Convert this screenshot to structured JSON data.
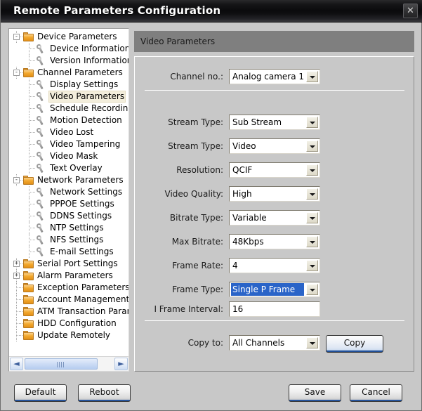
{
  "window": {
    "title": "Remote Parameters Configuration",
    "close_icon": "close-icon",
    "close_glyph": "✕"
  },
  "tree": {
    "nodes": [
      {
        "label": "Device Parameters",
        "depth": 0,
        "icon": "folder-icon",
        "expander": "-",
        "selected": false
      },
      {
        "label": "Device Information",
        "depth": 1,
        "icon": "wrench-icon",
        "expander": "",
        "selected": false
      },
      {
        "label": "Version Information",
        "depth": 1,
        "icon": "wrench-icon",
        "expander": "",
        "selected": false
      },
      {
        "label": "Channel Parameters",
        "depth": 0,
        "icon": "folder-icon",
        "expander": "-",
        "selected": false
      },
      {
        "label": "Display Settings",
        "depth": 1,
        "icon": "wrench-icon",
        "expander": "",
        "selected": false
      },
      {
        "label": "Video Parameters",
        "depth": 1,
        "icon": "wrench-icon",
        "expander": "",
        "selected": true
      },
      {
        "label": "Schedule Recording",
        "depth": 1,
        "icon": "wrench-icon",
        "expander": "",
        "selected": false
      },
      {
        "label": "Motion Detection",
        "depth": 1,
        "icon": "wrench-icon",
        "expander": "",
        "selected": false
      },
      {
        "label": "Video Lost",
        "depth": 1,
        "icon": "wrench-icon",
        "expander": "",
        "selected": false
      },
      {
        "label": "Video Tampering",
        "depth": 1,
        "icon": "wrench-icon",
        "expander": "",
        "selected": false
      },
      {
        "label": "Video Mask",
        "depth": 1,
        "icon": "wrench-icon",
        "expander": "",
        "selected": false
      },
      {
        "label": "Text Overlay",
        "depth": 1,
        "icon": "wrench-icon",
        "expander": "",
        "selected": false
      },
      {
        "label": "Network Parameters",
        "depth": 0,
        "icon": "folder-icon",
        "expander": "-",
        "selected": false
      },
      {
        "label": "Network Settings",
        "depth": 1,
        "icon": "wrench-icon",
        "expander": "",
        "selected": false
      },
      {
        "label": "PPPOE Settings",
        "depth": 1,
        "icon": "wrench-icon",
        "expander": "",
        "selected": false
      },
      {
        "label": "DDNS Settings",
        "depth": 1,
        "icon": "wrench-icon",
        "expander": "",
        "selected": false
      },
      {
        "label": "NTP Settings",
        "depth": 1,
        "icon": "wrench-icon",
        "expander": "",
        "selected": false
      },
      {
        "label": "NFS Settings",
        "depth": 1,
        "icon": "wrench-icon",
        "expander": "",
        "selected": false
      },
      {
        "label": "E-mail Settings",
        "depth": 1,
        "icon": "wrench-icon",
        "expander": "",
        "selected": false
      },
      {
        "label": "Serial Port Settings",
        "depth": 0,
        "icon": "folder-icon",
        "expander": "+",
        "selected": false
      },
      {
        "label": "Alarm Parameters",
        "depth": 0,
        "icon": "folder-icon",
        "expander": "+",
        "selected": false
      },
      {
        "label": "Exception Parameters",
        "depth": 0,
        "icon": "folder-icon",
        "expander": "",
        "selected": false
      },
      {
        "label": "Account Management",
        "depth": 0,
        "icon": "folder-icon",
        "expander": "",
        "selected": false
      },
      {
        "label": "ATM Transaction Parameters",
        "depth": 0,
        "icon": "folder-icon",
        "expander": "",
        "selected": false
      },
      {
        "label": "HDD Configuration",
        "depth": 0,
        "icon": "folder-icon",
        "expander": "",
        "selected": false
      },
      {
        "label": "Update Remotely",
        "depth": 0,
        "icon": "folder-icon",
        "expander": "",
        "selected": false
      }
    ],
    "scrollbar": {
      "left_arrow": "◄",
      "right_arrow": "►"
    }
  },
  "panel": {
    "header": "Video Parameters",
    "fields": [
      {
        "label": "Channel no.:",
        "value": "Analog camera 1",
        "type": "combo",
        "focused": false
      },
      {
        "label": "Stream Type:",
        "value": "Sub Stream",
        "type": "combo",
        "focused": false
      },
      {
        "label": "Stream Type:",
        "value": "Video",
        "type": "combo",
        "focused": false
      },
      {
        "label": "Resolution:",
        "value": "QCIF",
        "type": "combo",
        "focused": false
      },
      {
        "label": "Video Quality:",
        "value": "High",
        "type": "combo",
        "focused": false
      },
      {
        "label": "Bitrate Type:",
        "value": "Variable",
        "type": "combo",
        "focused": false
      },
      {
        "label": "Max Bitrate:",
        "value": "48Kbps",
        "type": "combo",
        "focused": false
      },
      {
        "label": "Frame Rate:",
        "value": "4",
        "type": "combo",
        "focused": false
      },
      {
        "label": "Frame Type:",
        "value": "Single P Frame",
        "type": "combo",
        "focused": true
      },
      {
        "label": "I Frame Interval:",
        "value": "16",
        "type": "text",
        "focused": false
      },
      {
        "label": "Copy to:",
        "value": "All Channels",
        "type": "combo",
        "focused": false
      }
    ],
    "copy_button": "Copy"
  },
  "footer": {
    "default_label": "Default",
    "reboot_label": "Reboot",
    "save_label": "Save",
    "cancel_label": "Cancel"
  },
  "colors": {
    "titlebar": "#0b0b0d",
    "section_head": "#7f7f7f",
    "dialog_bg": "#c8c8c8",
    "focus_highlight": "#2a64c8",
    "tree_selection": "#f3eedc",
    "folder": "#f2a92f",
    "button_accent": "#1d4a92"
  }
}
